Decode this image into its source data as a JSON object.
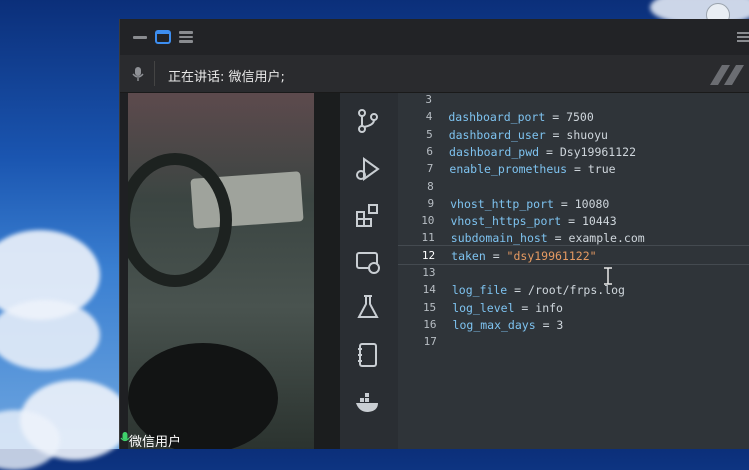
{
  "speaking_bar": {
    "text": "正在讲话: 微信用户;"
  },
  "participant": {
    "name": "微信用户"
  },
  "code": {
    "lines": [
      {
        "num": "3",
        "key": "",
        "eq": "",
        "val": "",
        "str": false
      },
      {
        "num": "4",
        "key": "dashboard_port",
        "eq": " = ",
        "val": "7500",
        "str": false
      },
      {
        "num": "5",
        "key": "dashboard_user",
        "eq": " = ",
        "val": "shuoyu",
        "str": false
      },
      {
        "num": "6",
        "key": "dashboard_pwd",
        "eq": " = ",
        "val": "Dsy19961122",
        "str": false
      },
      {
        "num": "7",
        "key": "enable_prometheus",
        "eq": " = ",
        "val": "true",
        "str": false
      },
      {
        "num": "8",
        "key": "",
        "eq": "",
        "val": "",
        "str": false
      },
      {
        "num": "9",
        "key": "vhost_http_port",
        "eq": " = ",
        "val": "10080",
        "str": false
      },
      {
        "num": "10",
        "key": "vhost_https_port",
        "eq": " = ",
        "val": "10443",
        "str": false
      },
      {
        "num": "11",
        "key": "subdomain_host",
        "eq": " = ",
        "val": "example.com",
        "str": false
      },
      {
        "num": "12",
        "key": "taken",
        "eq": " = ",
        "val": "\"dsy19961122\"",
        "str": true
      },
      {
        "num": "13",
        "key": "",
        "eq": "",
        "val": "",
        "str": false
      },
      {
        "num": "14",
        "key": "log_file",
        "eq": " = ",
        "val": "/root/frps.log",
        "str": false
      },
      {
        "num": "15",
        "key": "log_level",
        "eq": " = ",
        "val": "info",
        "str": false
      },
      {
        "num": "16",
        "key": "log_max_days",
        "eq": " = ",
        "val": "3",
        "str": false
      },
      {
        "num": "17",
        "key": "",
        "eq": "",
        "val": "",
        "str": false
      }
    ]
  },
  "sidebar_icons": [
    "source-control-icon",
    "run-debug-icon",
    "extensions-icon",
    "remote-explorer-icon",
    "testing-icon",
    "notebook-icon",
    "docker-icon"
  ],
  "colors": {
    "window_bg": "#1f2023",
    "editor_bg": "#2f3439",
    "key_color": "#7ec3f0",
    "string_color": "#e59a62",
    "titlebar_accent": "#3d8ef0"
  }
}
